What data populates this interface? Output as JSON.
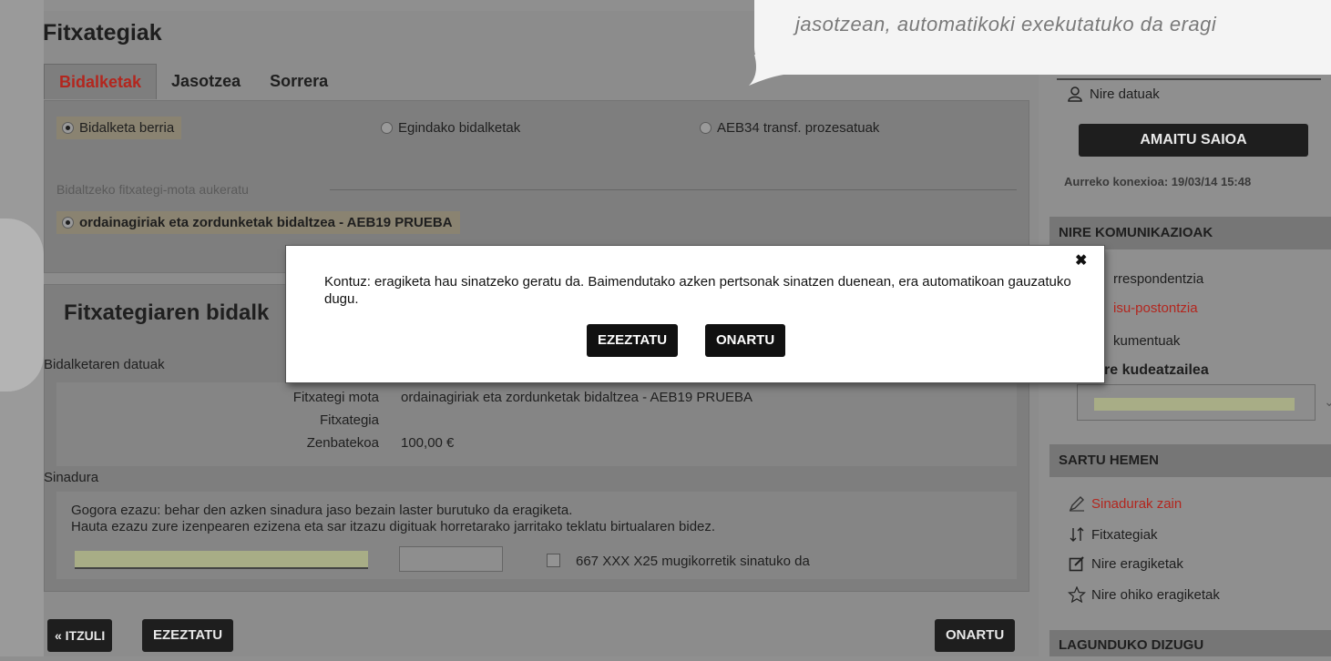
{
  "page_title": "Fitxategiak",
  "tabs": [
    {
      "label": "Bidalketak",
      "active": true
    },
    {
      "label": "Jasotzea",
      "active": false
    },
    {
      "label": "Sorrera",
      "active": false
    }
  ],
  "send_type": {
    "options": [
      "Bidalketa berria",
      "Egindako bidalketak",
      "AEB34 transf. prozesatuak"
    ],
    "selected": "Bidalketa berria"
  },
  "file_type_legend": "Bidaltzeko fitxategi-mota aukeratu",
  "file_type_selected": "ordainagiriak eta zordunketak bidaltzea - AEB19 PRUEBA",
  "section_title": "Fitxategiaren bidalk",
  "data_heading": "Bidalketaren datuak",
  "details": [
    {
      "label": "Fitxategi mota",
      "value": "ordainagiriak eta zordunketak bidaltzea - AEB19 PRUEBA"
    },
    {
      "label": "Fitxategia",
      "value": ""
    },
    {
      "label": "Zenbatekoa",
      "value": "100,00 €"
    }
  ],
  "signature": {
    "heading": "Sinadura",
    "line1": "Gogora ezazu: behar den azken sinadura jaso bezain laster burutuko da eragiketa.",
    "line2": "Hauta ezazu zure izenpearen ezizena eta sar itzazu digituak horretarako jarritako teklatu birtualaren bidez.",
    "mobile_check_label": "667 XXX X25 mugikorretik sinatuko da"
  },
  "bottom_buttons": {
    "back": "« ITZULI",
    "cancel": "EZEZTATU",
    "accept": "ONARTU"
  },
  "callout": {
    "text": "jasotzean, automatikoki exekutatuko da eragi"
  },
  "sidebar": {
    "my_data": "Nire datuak",
    "logout": "AMAITU SAIOA",
    "last_connection": "Aurreko konexioa: 19/03/14 15:48",
    "comms_title": "NIRE KOMUNIKAZIOAK",
    "comms_items": [
      "rrespondentzia",
      "isu-postontzia",
      "kumentuak",
      "re kudeatzailea"
    ],
    "enter_title": "SARTU HEMEN",
    "enter_items": [
      "Sinadurak zain",
      "Fitxategiak",
      "Nire eragiketak",
      "Nire ohiko eragiketak"
    ],
    "help_title": "LAGUNDUKO DIZUGU"
  },
  "modal": {
    "text": "Kontuz: eragiketa hau sinatzeko geratu da. Baimendutako azken pertsonak sinatzen duenean, era automatikoan gauzatuko dugu.",
    "cancel": "EZEZTATU",
    "accept": "ONARTU",
    "close": "✖"
  },
  "colors": {
    "accent_red": "#b3261e",
    "dark_button": "#1e1e1e"
  }
}
